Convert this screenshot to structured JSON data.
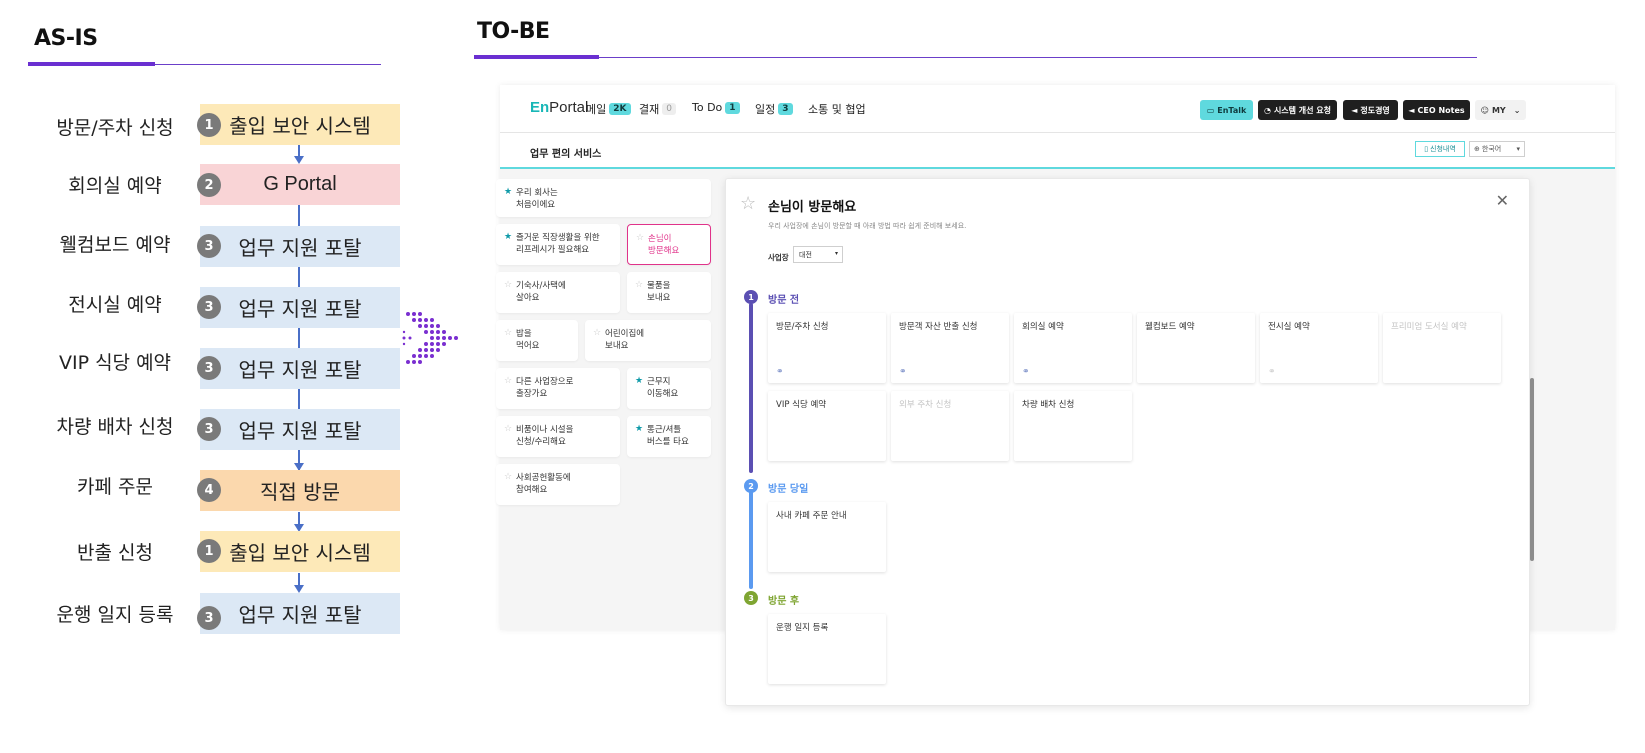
{
  "as_is": {
    "title": "AS-IS",
    "rows": [
      {
        "label": "방문/주차 신청",
        "num": "1",
        "system": "출입 보안 시스템",
        "color": "yellow"
      },
      {
        "label": "회의실 예약",
        "num": "2",
        "system": "G Portal",
        "color": "pink"
      },
      {
        "label": "웰컴보드 예약",
        "num": "3",
        "system": "업무 지원 포탈",
        "color": "blue"
      },
      {
        "label": "전시실 예약",
        "num": "3",
        "system": "업무 지원 포탈",
        "color": "blue"
      },
      {
        "label": "VIP 식당 예약",
        "num": "3",
        "system": "업무 지원 포탈",
        "color": "blue"
      },
      {
        "label": "차량 배차 신청",
        "num": "3",
        "system": "업무 지원 포탈",
        "color": "blue"
      },
      {
        "label": "카페 주문",
        "num": "4",
        "system": "직접 방문",
        "color": "orange"
      },
      {
        "label": "반출 신청",
        "num": "1",
        "system": "출입 보안 시스템",
        "color": "yellow"
      },
      {
        "label": "운행 일지 등록",
        "num": "3",
        "system": "업무 지원 포탈",
        "color": "blue"
      }
    ]
  },
  "to_be": {
    "title": "TO-BE",
    "logo": {
      "en": "En",
      "rest": "Portal"
    },
    "nav": {
      "mail": "메일",
      "mail_badge": "2K",
      "approval": "결재",
      "approval_badge": "0",
      "todo": "To Do",
      "todo_badge": "1",
      "schedule": "일정",
      "schedule_badge": "3",
      "comm": "소통 및 협업"
    },
    "top_buttons": {
      "entalk": "EnTalk",
      "improve": "시스템 개선 요청",
      "ethics": "정도경영",
      "ceo": "CEO Notes",
      "my": "MY"
    },
    "subbar": {
      "title": "업무 편의 서비스",
      "history": "신청내역",
      "language": "한국어"
    },
    "cards": [
      {
        "line1": "우리 회사는",
        "line2": "처음이에요",
        "starred": true
      },
      {
        "line1": "즐거운 직장생활을 위한",
        "line2": "리프레시가 필요해요",
        "starred": true
      },
      {
        "line1": "손님이",
        "line2": "방문해요",
        "starred": false
      },
      {
        "line1": "기숙사/사택에",
        "line2": "살아요",
        "starred": false
      },
      {
        "line1": "물품을",
        "line2": "보내요",
        "starred": false
      },
      {
        "line1": "밥을",
        "line2": "먹어요",
        "starred": false
      },
      {
        "line1": "어린이집에",
        "line2": "보내요",
        "starred": false
      },
      {
        "line1": "다른 사업장으로",
        "line2": "출장가요",
        "starred": false
      },
      {
        "line1": "근무지",
        "line2": "이동해요",
        "starred": true
      },
      {
        "line1": "비품이나 시설을",
        "line2": "신청/수리해요",
        "starred": false
      },
      {
        "line1": "통근/셔틀",
        "line2": "버스를 타요",
        "starred": true
      },
      {
        "line1": "사회공헌활동에",
        "line2": "참여해요",
        "starred": false
      }
    ],
    "panel": {
      "title": "손님이 방문해요",
      "desc": "우리 사업장에 손님이 방문할 때 아래 방법 따라 쉽게 준비해 보세요.",
      "site_label": "사업장",
      "site_value": "대전",
      "steps": [
        {
          "num": "1",
          "title": "방문 전",
          "color": "#5b4fb3",
          "items": [
            {
              "label": "방문/주차 신청",
              "dim": false,
              "link": true
            },
            {
              "label": "방문객 자산 반출 신청",
              "dim": false,
              "link": true
            },
            {
              "label": "회의실 예약",
              "dim": false,
              "link": true
            },
            {
              "label": "웰컴보드 예약",
              "dim": false,
              "link": false
            },
            {
              "label": "전시실 예약",
              "dim": false,
              "link": true
            },
            {
              "label": "프리미엄 도서실 예약",
              "dim": true,
              "link": false
            },
            {
              "label": "VIP 식당 예약",
              "dim": false,
              "link": false
            },
            {
              "label": "외부 주차 신청",
              "dim": true,
              "link": false
            },
            {
              "label": "차량 배차 신청",
              "dim": false,
              "link": false
            }
          ]
        },
        {
          "num": "2",
          "title": "방문 당일",
          "color": "#5b9af0",
          "items": [
            {
              "label": "사내 카페 주문 안내",
              "dim": false,
              "link": false
            }
          ]
        },
        {
          "num": "3",
          "title": "방문 후",
          "color": "#7fa532",
          "items": [
            {
              "label": "운행 일지 등록",
              "dim": false,
              "link": false
            }
          ]
        }
      ]
    }
  },
  "colors": {
    "accent": "#6a2fd1",
    "teal": "#5fd9de",
    "flow": "#4a6fc7"
  },
  "icons": [
    "star-icon",
    "close-icon",
    "link-icon",
    "chevron-down-icon",
    "chat-icon",
    "headset-icon",
    "megaphone-icon",
    "user-icon",
    "document-icon",
    "globe-icon"
  ]
}
